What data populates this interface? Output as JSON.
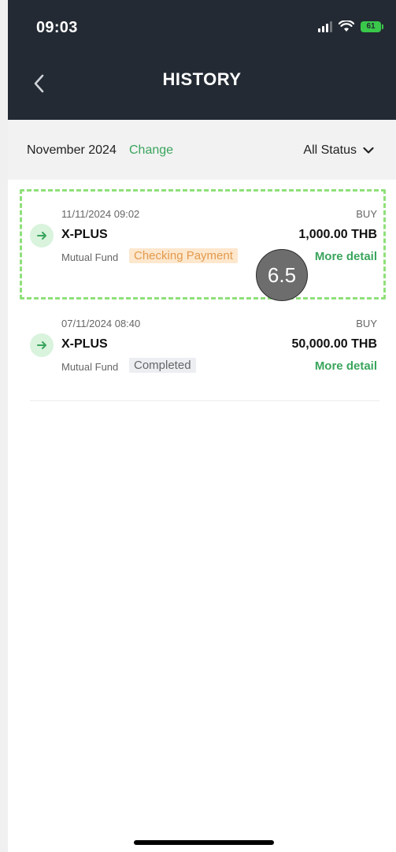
{
  "status_bar": {
    "time": "09:03",
    "battery": "61"
  },
  "header": {
    "title": "HISTORY"
  },
  "filter": {
    "month": "November 2024",
    "change_label": "Change",
    "status_label": "All Status"
  },
  "transactions": [
    {
      "datetime": "11/11/2024 09:02",
      "type": "BUY",
      "name": "X-PLUS",
      "amount": "1,000.00 THB",
      "category": "Mutual Fund",
      "status": "Checking Payment",
      "more": "More detail"
    },
    {
      "datetime": "07/11/2024 08:40",
      "type": "BUY",
      "name": "X-PLUS",
      "amount": "50,000.00 THB",
      "category": "Mutual Fund",
      "status": "Completed",
      "more": "More detail"
    }
  ],
  "annotation": {
    "label": "6.5"
  },
  "colors": {
    "header_bg": "#232a33",
    "accent_green": "#3aa55d",
    "badge_checking_bg": "#fde7cd",
    "badge_checking_text": "#e39a4c",
    "highlight_border": "#8fe07a"
  },
  "icons": {
    "back": "chevron-left-icon",
    "filter": "chevron-down-icon",
    "transaction": "arrow-right-icon"
  }
}
